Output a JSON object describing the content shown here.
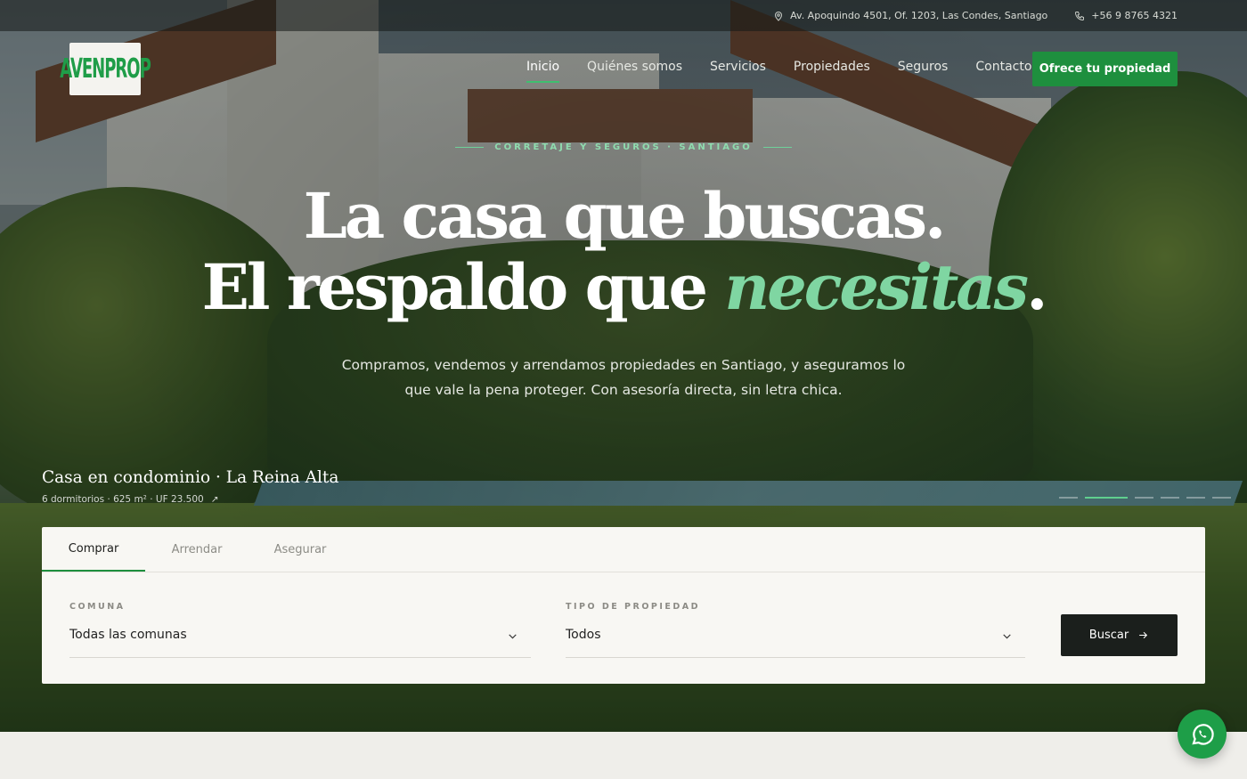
{
  "topbar": {
    "address": "Av. Apoquindo 4501, Of. 1203, Las Condes, Santiago",
    "phone": "+56 9 8765 4321"
  },
  "brand": {
    "logo_text": "AVENPROP",
    "color": "#1f9d48"
  },
  "nav": {
    "items": [
      {
        "label": "Inicio",
        "active": true
      },
      {
        "label": "Quiénes somos"
      },
      {
        "label": "Servicios"
      },
      {
        "label": "Propiedades"
      },
      {
        "label": "Seguros"
      },
      {
        "label": "Contacto"
      }
    ],
    "cta": "Ofrece tu propiedad"
  },
  "hero": {
    "eyebrow": "CORRETAJE Y SEGUROS · SANTIAGO",
    "headline_line1": "La casa que buscas.",
    "headline_line2_prefix": "El respaldo que ",
    "headline_line2_emphasis": "necesitas",
    "headline_line2_suffix": ".",
    "subtitle": "Compramos, vendemos y arrendamos propiedades en Santiago, y aseguramos lo que vale la pena proteger. Con asesoría directa, sin letra chica.",
    "slide": {
      "title": "Casa en condominio · La Reina Alta",
      "meta": "6 dormitorios · 625 m² · UF 23.500",
      "arrow": "↗"
    },
    "slider": {
      "count": 6,
      "active_index": 1
    }
  },
  "search": {
    "tabs": [
      {
        "label": "Comprar",
        "active": true
      },
      {
        "label": "Arrendar"
      },
      {
        "label": "Asegurar"
      }
    ],
    "comuna_label": "COMUNA",
    "comuna_value": "Todas las comunas",
    "tipo_label": "TIPO DE PROPIEDAD",
    "tipo_value": "Todos",
    "button": "Buscar"
  },
  "colors": {
    "accent": "#1e8f3e",
    "accent_light": "#7fd6a2",
    "dark": "#1b1f1c"
  },
  "icons": [
    "location-pin-icon",
    "phone-icon",
    "chevron-down-icon",
    "arrow-right-icon",
    "arrow-up-right-icon",
    "whatsapp-icon"
  ]
}
